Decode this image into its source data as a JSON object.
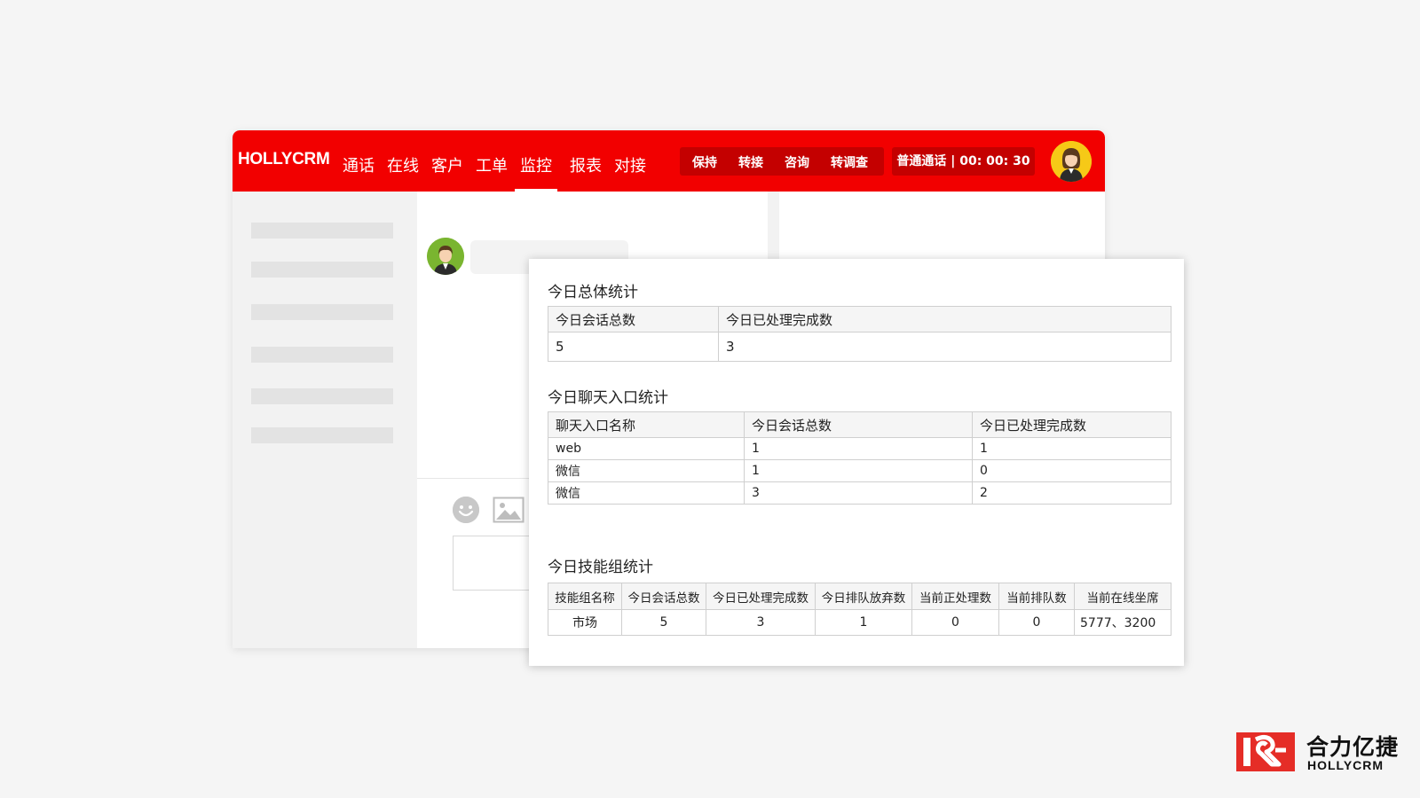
{
  "topbar": {
    "brand": "HOLLYCRM",
    "nav": [
      "通话",
      "在线",
      "客户",
      "工单",
      "监控",
      "报表",
      "对接"
    ],
    "active_nav": "监控",
    "call_actions": [
      "保持",
      "转接",
      "咨询",
      "转调查"
    ],
    "call_timer": "普通通话 | 00:  00:  30",
    "agent_avatar_icon": "female-agent-avatar-icon"
  },
  "chat": {
    "customer_avatar_icon": "male-customer-avatar-icon",
    "emoji_icon": "smiley-icon",
    "image_icon": "image-icon"
  },
  "stats": {
    "overall": {
      "title": "今日总体统计",
      "headers": [
        "今日会话总数",
        "今日已处理完成数"
      ],
      "row": [
        "5",
        "3"
      ]
    },
    "entry": {
      "title": "今日聊天入口统计",
      "headers": [
        "聊天入口名称",
        "今日会话总数",
        "今日已处理完成数"
      ],
      "rows": [
        [
          "web",
          "1",
          "1"
        ],
        [
          "微信",
          "1",
          "0"
        ],
        [
          "微信",
          "3",
          "2"
        ]
      ]
    },
    "skill": {
      "title": "今日技能组统计",
      "headers": [
        "技能组名称",
        "今日会话总数",
        "今日已处理完成数",
        "今日排队放弃数",
        "当前正处理数",
        "当前排队数",
        "当前在线坐席"
      ],
      "rows": [
        [
          "市场",
          "5",
          "3",
          "1",
          "0",
          "0",
          "5777、3200"
        ]
      ]
    }
  },
  "logo": {
    "cn": "合力亿捷",
    "en": "HOLLYCRM",
    "colors": {
      "brand_red": "#e52d27"
    }
  },
  "colors": {
    "topbar": "#f20000",
    "topbar_dark": "#c40000"
  }
}
